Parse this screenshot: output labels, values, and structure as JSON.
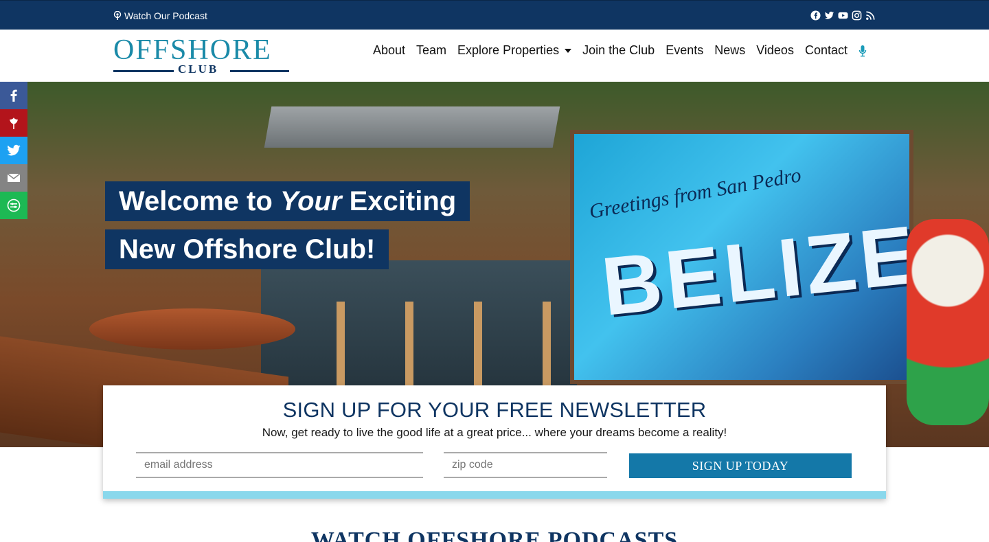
{
  "topbar": {
    "podcast_link": "Watch Our Podcast",
    "social_icons": [
      "facebook-icon",
      "twitter-icon",
      "youtube-icon",
      "instagram-icon",
      "rss-icon"
    ]
  },
  "header": {
    "logo_word": "OFFSHORE",
    "logo_sub": "CLUB",
    "nav": {
      "about": "About",
      "team": "Team",
      "explore": "Explore Properties",
      "join": "Join the Club",
      "events": "Events",
      "news": "News",
      "videos": "Videos",
      "contact": "Contact"
    }
  },
  "hero": {
    "title_line1_a": "Welcome to ",
    "title_line1_em": "Your",
    "title_line1_b": " Exciting",
    "title_line2": "New Offshore Club!",
    "mural_greeting": "Greetings from San Pedro",
    "mural_word": "BELIZE"
  },
  "share_bar": [
    "facebook-share",
    "pinterest-share",
    "twitter-share",
    "email-share",
    "more-share"
  ],
  "newsletter": {
    "title": "SIGN UP FOR YOUR FREE NEWSLETTER",
    "subtitle": "Now, get ready to live the good life at a great price... where your dreams become a reality!",
    "email_placeholder": "email address",
    "zip_placeholder": "zip code",
    "button": "SIGN UP TODAY"
  },
  "podcasts_heading": "WATCH OFFSHORE PODCASTS",
  "colors": {
    "navy": "#0f3562",
    "teal": "#1a8aa8",
    "button_blue": "#1478a8",
    "accent_light": "#8ad8ec"
  }
}
